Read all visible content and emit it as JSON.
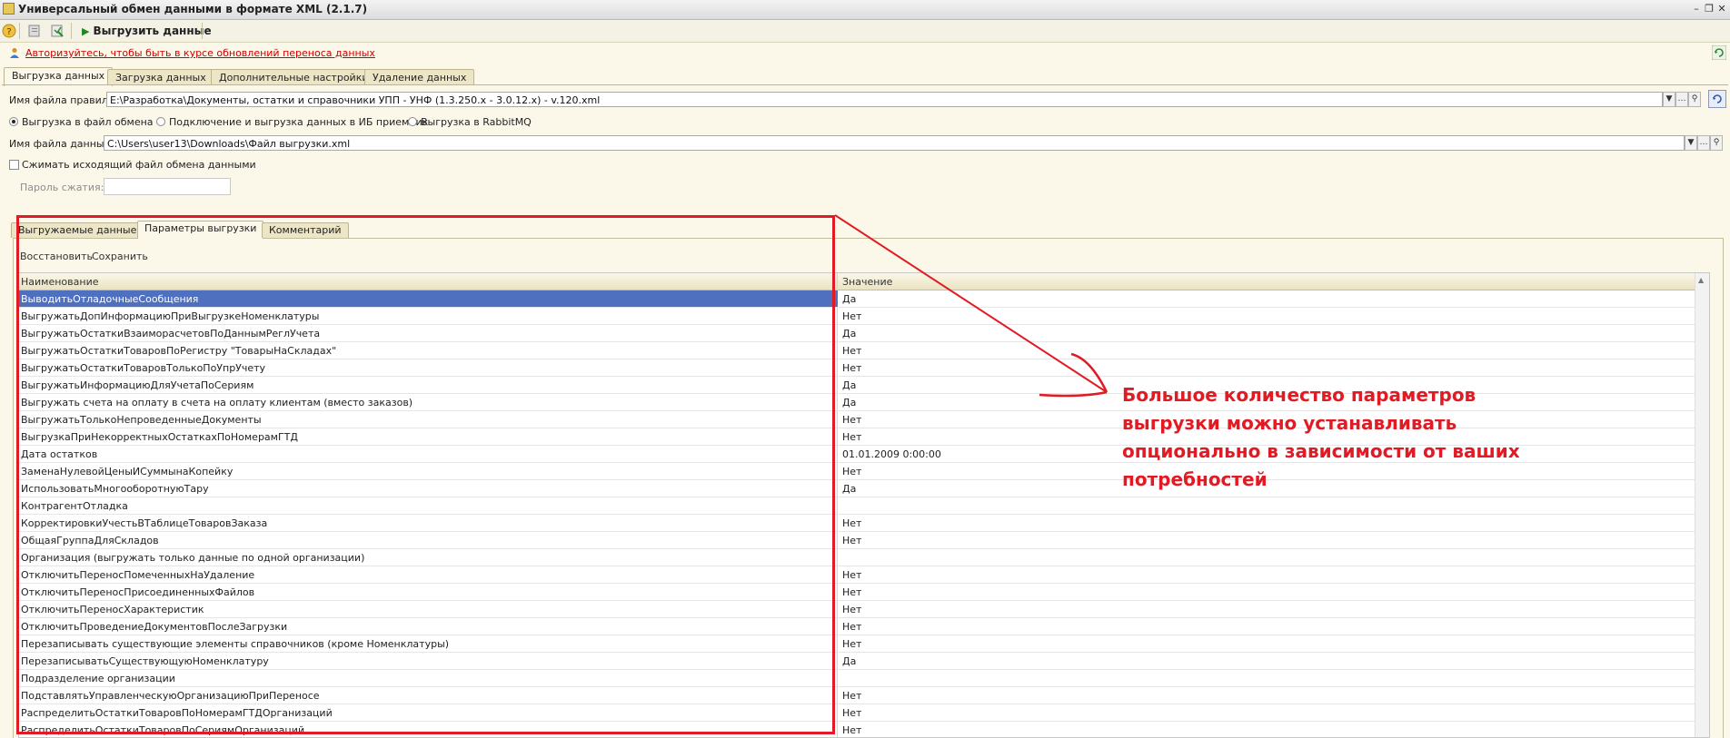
{
  "window": {
    "title": "Универсальный обмен данными в формате XML (2.1.7)"
  },
  "toolbar": {
    "export_label": "Выгрузить данные"
  },
  "auth_link": "Авторизуйтесь, чтобы быть в курсе обновлений переноса данных",
  "tabs": [
    "Выгрузка данных",
    "Загрузка данных",
    "Дополнительные настройки",
    "Удаление данных"
  ],
  "rules_file": {
    "label": "Имя файла правил:",
    "value": "E:\\Разработка\\Документы, остатки и справочники УПП - УНФ (1.3.250.x - 3.0.12.x) - v.120.xml"
  },
  "export_modes": {
    "options": [
      "Выгрузка в файл обмена",
      "Подключение и выгрузка данных в ИБ приемник",
      "Выгрузка в RabbitMQ"
    ],
    "selected": 0
  },
  "data_file": {
    "label": "Имя файла данных:",
    "value": "C:\\Users\\user13\\Downloads\\Файл выгрузки.xml"
  },
  "compress": {
    "label": "Сжимать исходящий файл обмена данными",
    "checked": false
  },
  "password": {
    "label": "Пароль сжатия:",
    "value": ""
  },
  "inner_tabs": [
    "Выгружаемые данные",
    "Параметры выгрузки",
    "Комментарий"
  ],
  "commands": {
    "restore": "Восстановить",
    "save": "Сохранить"
  },
  "grid": {
    "col_name": "Наименование",
    "col_value": "Значение",
    "rows": [
      {
        "name": "ВыводитьОтладочныеСообщения",
        "value": "Да"
      },
      {
        "name": "ВыгружатьДопИнформациюПриВыгрузкеНоменклатуры",
        "value": "Нет"
      },
      {
        "name": "ВыгружатьОстаткиВзаиморасчетовПоДаннымРеглУчета",
        "value": "Да"
      },
      {
        "name": "ВыгружатьОстаткиТоваровПоРегистру \"ТоварыНаСкладах\"",
        "value": "Нет"
      },
      {
        "name": "ВыгружатьОстаткиТоваровТолькоПоУпрУчету",
        "value": "Нет"
      },
      {
        "name": "ВыгружатьИнформациюДляУчетаПоСериям",
        "value": "Да"
      },
      {
        "name": "Выгружать счета на оплату в счета на оплату клиентам (вместо заказов)",
        "value": "Да"
      },
      {
        "name": "ВыгружатьТолькоНепроведенныеДокументы",
        "value": "Нет"
      },
      {
        "name": "ВыгрузкаПриНекорректныхОстаткахПоНомерамГТД",
        "value": "Нет"
      },
      {
        "name": "Дата остатков",
        "value": "01.01.2009 0:00:00"
      },
      {
        "name": "ЗаменаНулевойЦеныИСуммынаКопейку",
        "value": "Нет"
      },
      {
        "name": "ИспользоватьМногооборотнуюТару",
        "value": "Да"
      },
      {
        "name": "КонтрагентОтладка",
        "value": ""
      },
      {
        "name": "КорректировкиУчестьВТаблицеТоваровЗаказа",
        "value": "Нет"
      },
      {
        "name": "ОбщаяГруппаДляСкладов",
        "value": "Нет"
      },
      {
        "name": "Организация (выгружать только данные по одной организации)",
        "value": ""
      },
      {
        "name": "ОтключитьПереносПомеченныхНаУдаление",
        "value": "Нет"
      },
      {
        "name": "ОтключитьПереносПрисоединенныхФайлов",
        "value": "Нет"
      },
      {
        "name": "ОтключитьПереносХарактеристик",
        "value": "Нет"
      },
      {
        "name": "ОтключитьПроведениеДокументовПослеЗагрузки",
        "value": "Нет"
      },
      {
        "name": "Перезаписывать существующие элементы справочников (кроме Номенклатуры)",
        "value": "Нет"
      },
      {
        "name": "ПерезаписыватьСуществующуюНоменклатуру",
        "value": "Да"
      },
      {
        "name": "Подразделение организации",
        "value": ""
      },
      {
        "name": "ПодставлятьУправленческуюОрганизациюПриПереносе",
        "value": "Нет"
      },
      {
        "name": "РаспределитьОстаткиТоваровПоНомерамГТДОрганизаций",
        "value": "Нет"
      },
      {
        "name": "РаспределитьОстаткиТоваровПоСериямОрганизаций",
        "value": "Нет"
      }
    ]
  },
  "annotation": {
    "lines": [
      "Большое количество параметров",
      "выгрузки можно устанавливать",
      "опционально в зависимости от ваших",
      "потребностей"
    ],
    "color": "#e21a23"
  }
}
